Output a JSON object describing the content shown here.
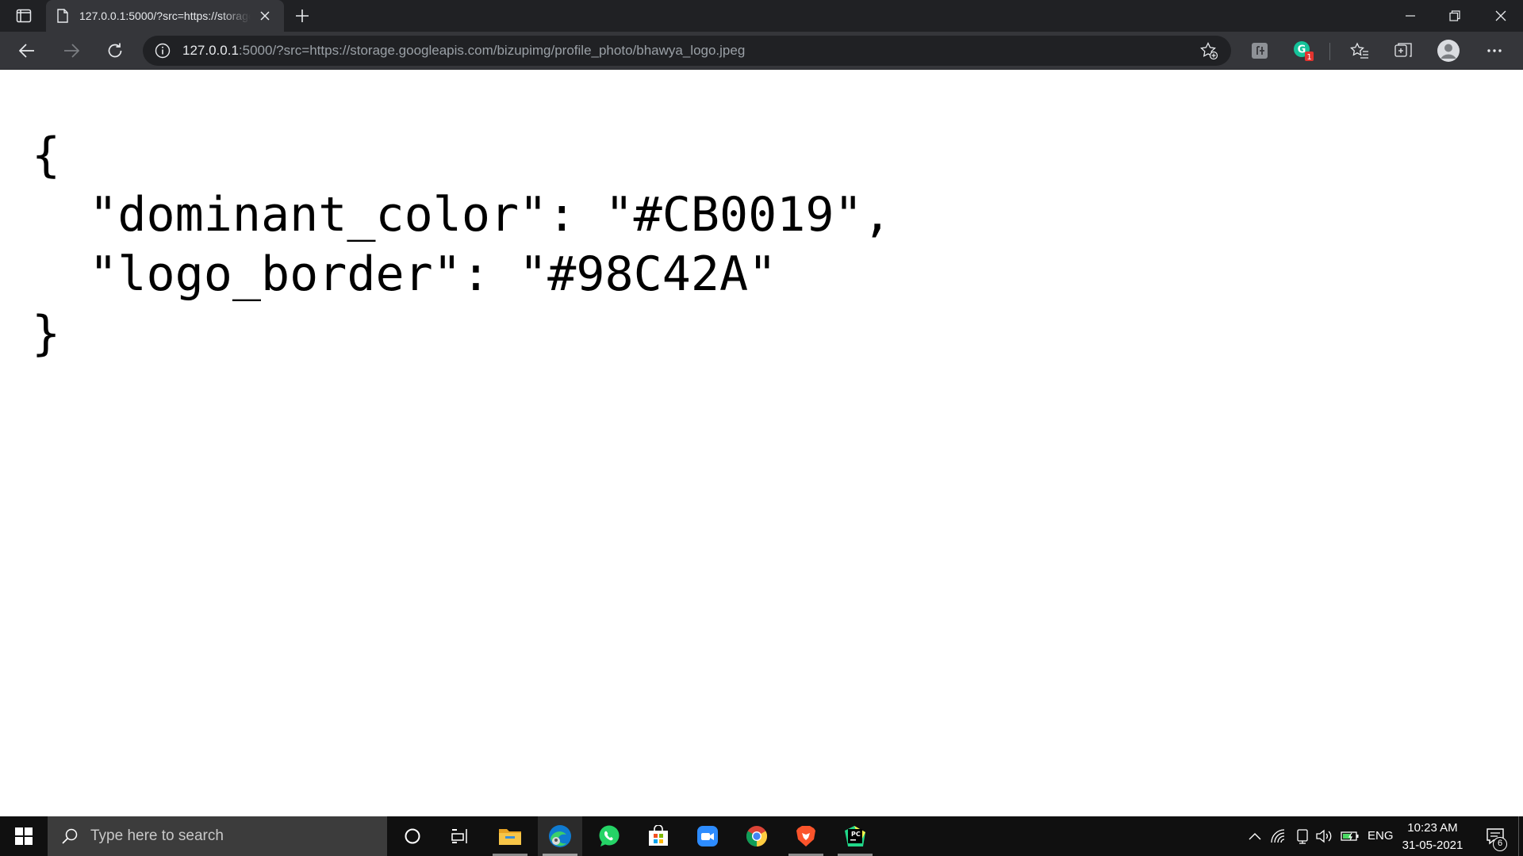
{
  "browser": {
    "tab_title": "127.0.0.1:5000/?src=https://storage.googleapis.com/bizupimg/profile_photo/bhawya_logo.jpeg",
    "url_host": "127.0.0.1",
    "url_rest": ":5000/?src=https://storage.googleapis.com/bizupimg/profile_photo/bhawya_logo.jpeg",
    "extension_badge": "1"
  },
  "json_view": {
    "open_brace": "{",
    "line1": "  \"dominant_color\": \"#CB0019\",",
    "line2": "  \"logo_border\": \"#98C42A\"",
    "close_brace": "}"
  },
  "taskbar": {
    "search_placeholder": "Type here to search",
    "language": "ENG",
    "time": "10:23 AM",
    "date": "31-05-2021",
    "notification_count": "6",
    "apps": [
      "cortana-icon",
      "task-view-icon",
      "file-explorer-icon",
      "edge-icon",
      "whatsapp-icon",
      "store-icon",
      "zoom-icon",
      "chrome-icon",
      "brave-icon",
      "pycharm-icon"
    ]
  },
  "colors": {
    "titlebar": "#202124",
    "toolbar": "#35363a",
    "taskbar": "#101010"
  }
}
